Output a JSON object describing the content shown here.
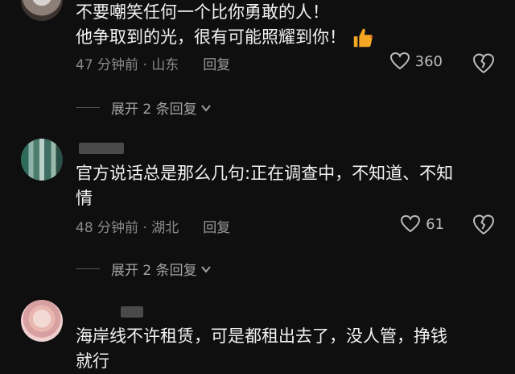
{
  "comments": [
    {
      "text_line1": "不要嘲笑任何一个比你勇敢的人！",
      "text_line2": "他争取到的光，很有可能照耀到你！",
      "meta": "47 分钟前 · 山东",
      "reply": "回复",
      "likes": "360",
      "expand": "展开 2 条回复"
    },
    {
      "text_line1": "官方说话总是那么几句:正在调查中，不知道、不知",
      "text_line2": "情",
      "meta": "48 分钟前 · 湖北",
      "reply": "回复",
      "likes": "61",
      "expand": "展开 2 条回复"
    },
    {
      "text_line1": "海岸线不许租赁，可是都租出去了，没人管，挣钱",
      "text_line2": "就行"
    }
  ],
  "icons": {
    "like": "heart-icon",
    "dislike": "broken-heart-icon",
    "thumbs_up": "thumbs-up-emoji",
    "expand": "chevron-down-icon"
  },
  "colors": {
    "background": "#0f0f0f",
    "text": "#f2f2f2",
    "meta": "#8a8a8a",
    "emoji": "#f5a623"
  }
}
